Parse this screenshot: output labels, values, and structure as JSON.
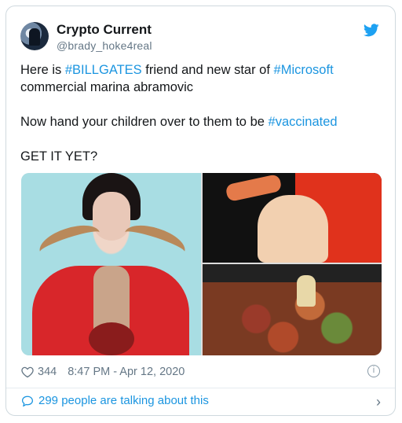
{
  "tweet": {
    "author_name": "Crypto Current",
    "author_handle": "@brady_hoke4real",
    "line1_pre": "Here is ",
    "line1_tag1": "#BILLGATES",
    "line1_mid": " friend and new star of ",
    "line1_tag2": "#Microsoft",
    "line2": " commercial marina abramovic",
    "line3_pre": "Now hand your children over to them to be ",
    "line3_tag": "#vaccinated",
    "line4": "GET IT YET?",
    "like_count": "344",
    "timestamp": "8:47 PM - Apr 12, 2020",
    "info_glyph": "i",
    "talking_text": "299 people are talking about this",
    "chevron_glyph": "›"
  },
  "colors": {
    "link": "#1b95e0",
    "muted": "#657786",
    "border": "#cfd9de"
  },
  "icons": [
    "avatar",
    "twitter-bird-icon",
    "heart-icon",
    "info-icon",
    "speech-bubble-icon",
    "chevron-right-icon"
  ]
}
